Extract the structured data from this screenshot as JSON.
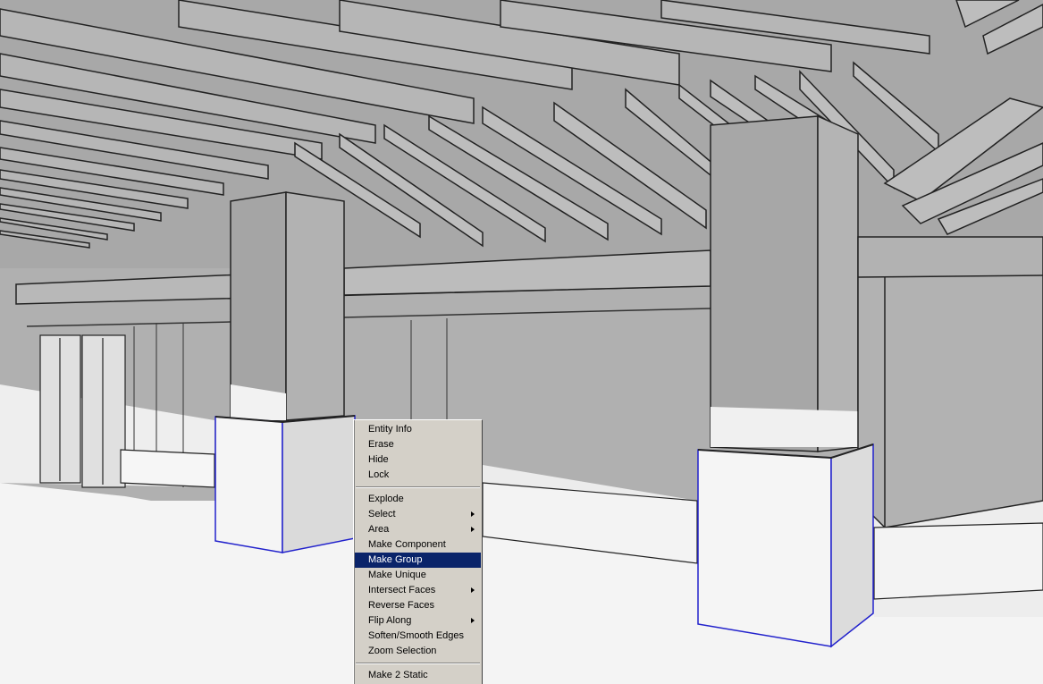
{
  "context_menu": {
    "groups": [
      [
        {
          "label": "Entity Info",
          "submenu": false
        },
        {
          "label": "Erase",
          "submenu": false
        },
        {
          "label": "Hide",
          "submenu": false
        },
        {
          "label": "Lock",
          "submenu": false
        }
      ],
      [
        {
          "label": "Explode",
          "submenu": false
        },
        {
          "label": "Select",
          "submenu": true
        },
        {
          "label": "Area",
          "submenu": true
        },
        {
          "label": "Make Component",
          "submenu": false
        },
        {
          "label": "Make Group",
          "submenu": false,
          "highlighted": true
        },
        {
          "label": "Make Unique",
          "submenu": false
        },
        {
          "label": "Intersect Faces",
          "submenu": true
        },
        {
          "label": "Reverse Faces",
          "submenu": false
        },
        {
          "label": "Flip Along",
          "submenu": true
        },
        {
          "label": "Soften/Smooth Edges",
          "submenu": false
        },
        {
          "label": "Zoom Selection",
          "submenu": false
        }
      ],
      [
        {
          "label": "Make 2 Static",
          "submenu": false
        }
      ]
    ],
    "highlight_color": "#0a246a"
  },
  "scene": {
    "selection_color": "#2222cc",
    "face_color": "#a9a9a9",
    "ground_color": "#f4f4f4"
  }
}
